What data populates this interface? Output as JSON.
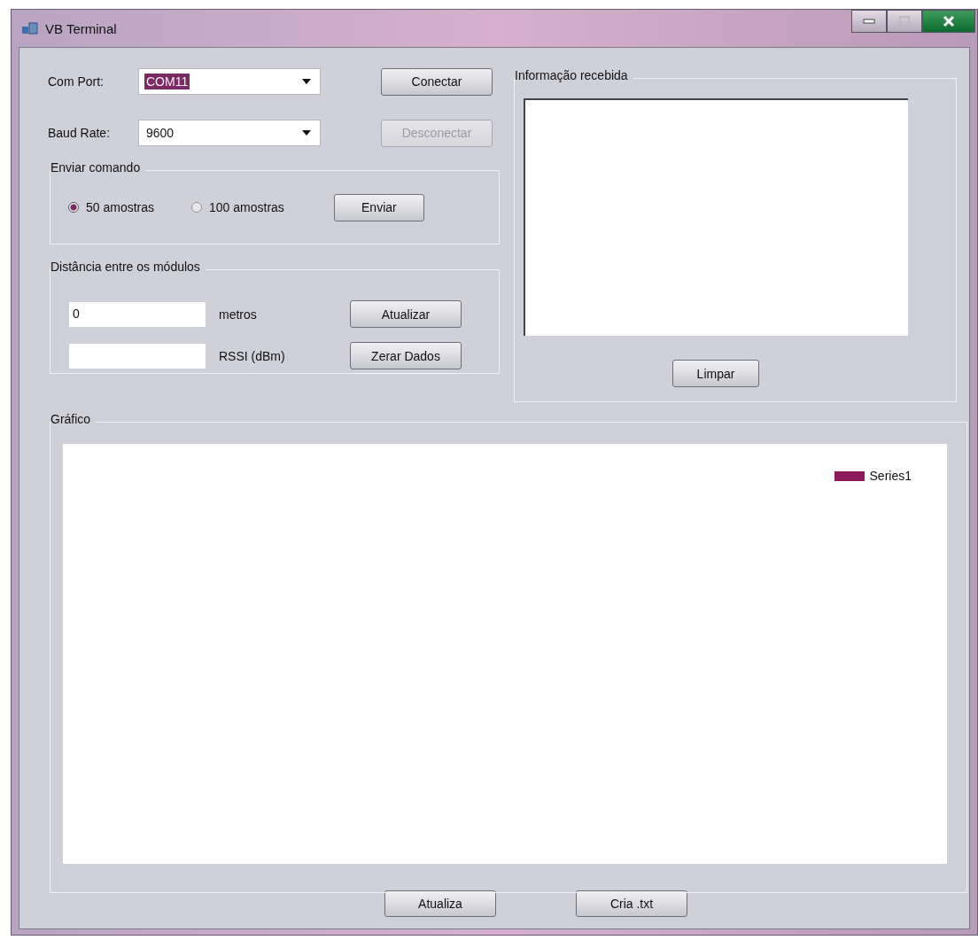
{
  "window": {
    "title": "VB Terminal"
  },
  "connection": {
    "fields": [
      {
        "label": "Com Port:",
        "value": "COM11",
        "text_selected": true
      },
      {
        "label": "Baud Rate:",
        "value": "9600",
        "text_selected": false
      }
    ],
    "buttons": [
      {
        "label": "Conectar",
        "disabled": false
      },
      {
        "label": "Desconectar",
        "disabled": true
      }
    ]
  },
  "send_command": {
    "title": "Enviar comando",
    "options": [
      {
        "label": "50 amostras",
        "selected": true
      },
      {
        "label": "100 amostras",
        "selected": false
      }
    ],
    "button": "Enviar"
  },
  "distance": {
    "title": "Distância entre os módulos",
    "rows": [
      {
        "value": "0",
        "unit": "metros",
        "button": "Atualizar"
      },
      {
        "value": "",
        "unit": "RSSI (dBm)",
        "button": "Zerar Dados"
      }
    ]
  },
  "received": {
    "title": "Informação recebida",
    "button": "Limpar"
  },
  "chart": {
    "title": "Gráfico",
    "legend": [
      {
        "name": "Series1",
        "color": "#8b1a5a"
      }
    ]
  },
  "bottom_buttons": [
    "Atualiza",
    "Cria .txt"
  ]
}
